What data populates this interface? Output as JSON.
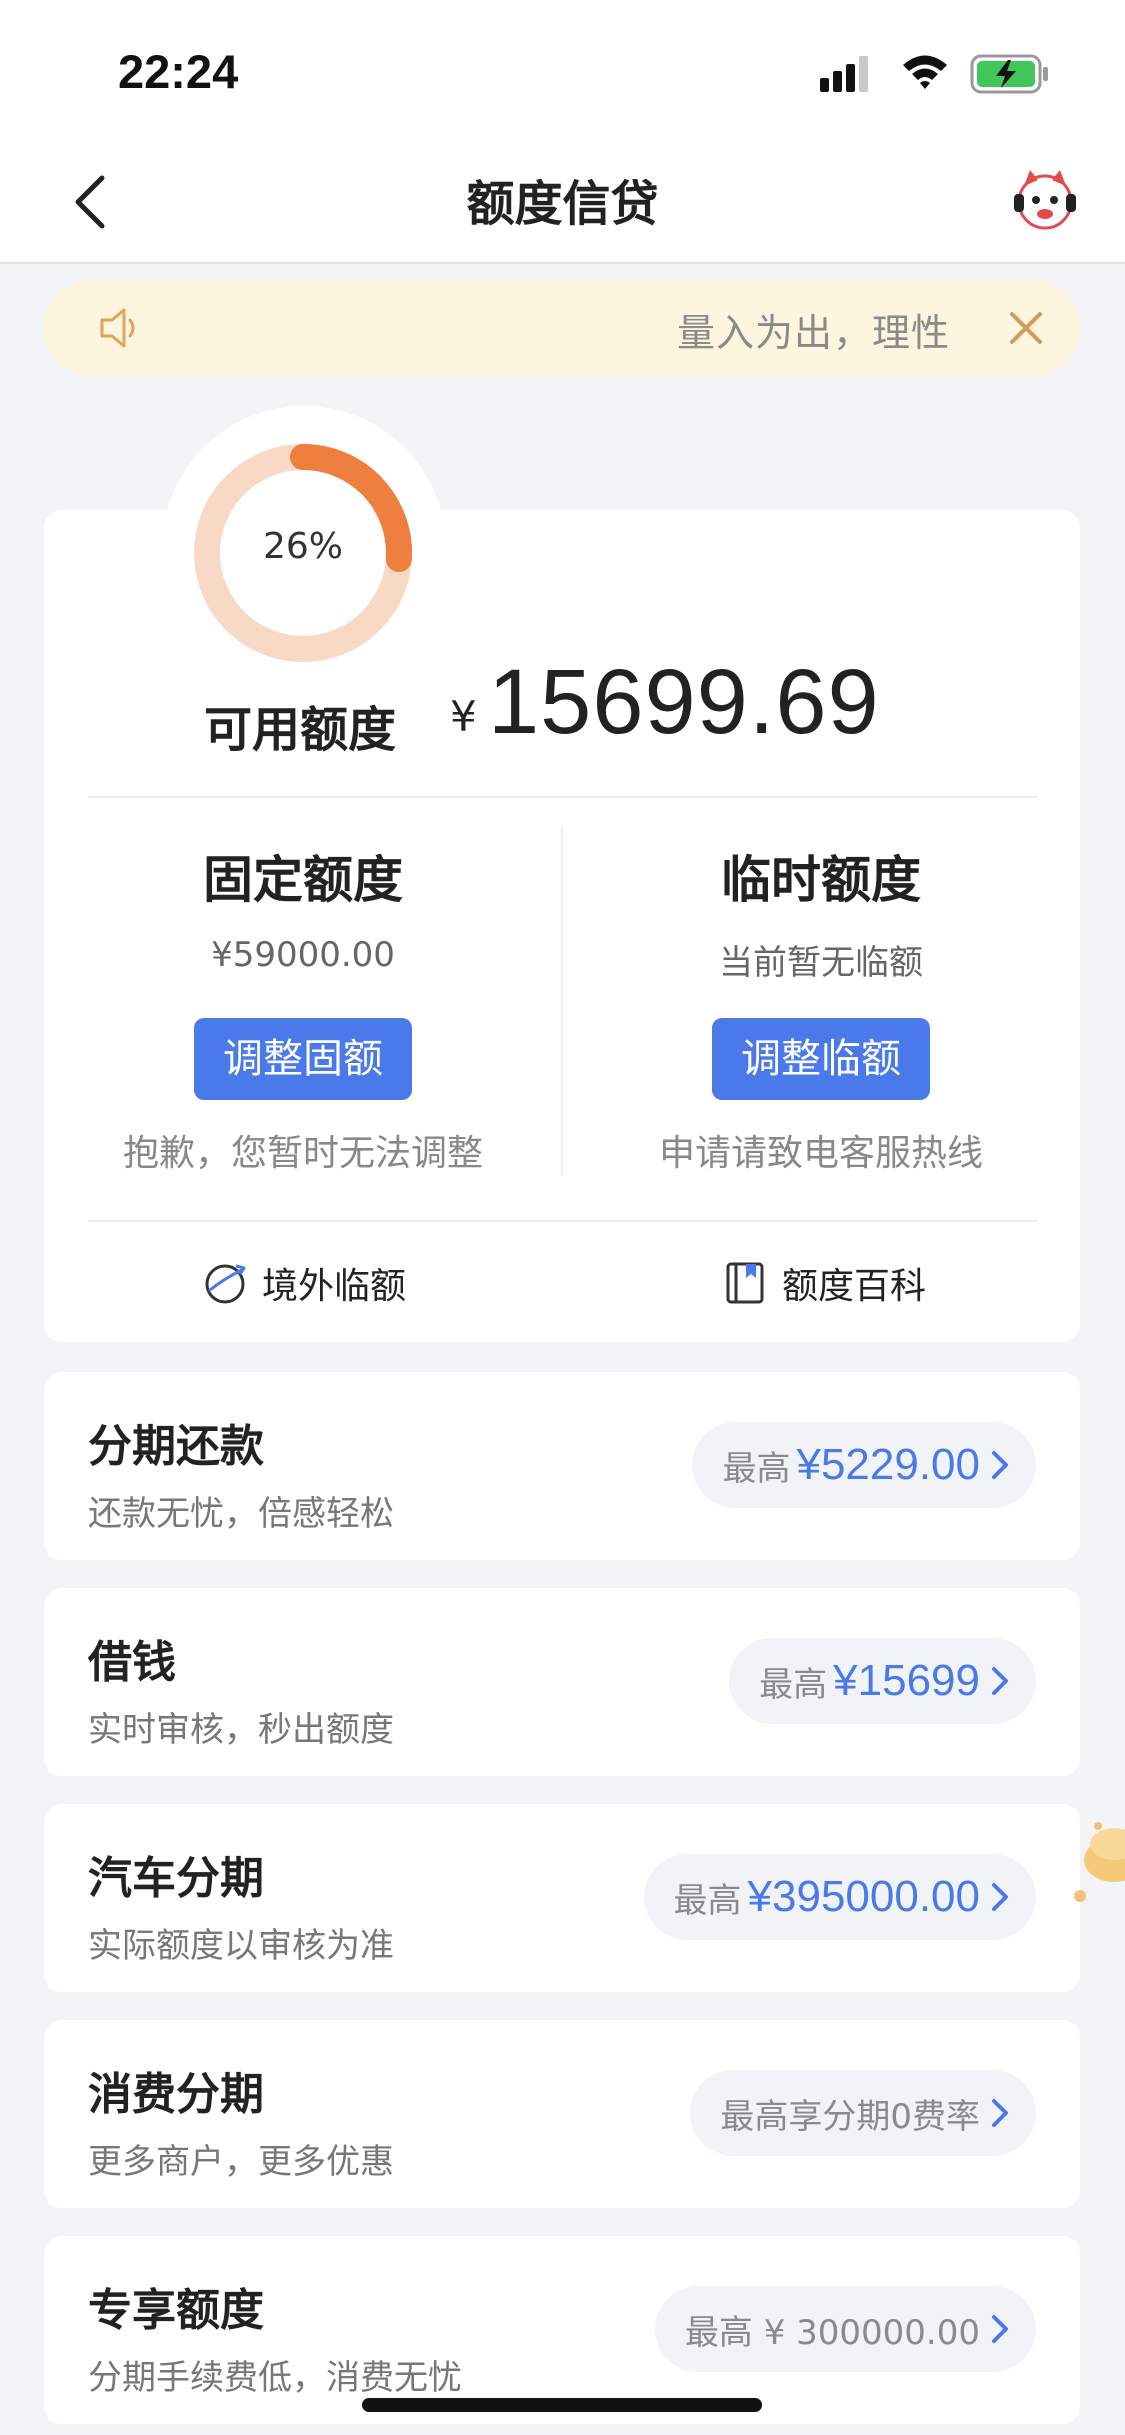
{
  "status_bar": {
    "time": "22:24"
  },
  "nav": {
    "title": "额度信贷"
  },
  "notice": {
    "text": "量入为出，理性"
  },
  "quota": {
    "used_percent_label": "26%",
    "used_percent": 0.26,
    "available_label": "可用额度",
    "currency": "¥",
    "available_amount": "15699.69",
    "fixed": {
      "title": "固定额度",
      "value": "¥59000.00",
      "button": "调整固额",
      "note": "抱歉，您暂时无法调整"
    },
    "temp": {
      "title": "临时额度",
      "value": "当前暂无临额",
      "button": "调整临额",
      "note": "申请请致电客服热线"
    },
    "links": {
      "overseas": "境外临额",
      "wiki": "额度百科"
    }
  },
  "products": [
    {
      "title": "分期还款",
      "subtitle": "还款无忧，倍感轻松",
      "prefix": "最高",
      "amount": "¥5229.00"
    },
    {
      "title": "借钱",
      "subtitle": "实时审核，秒出额度",
      "prefix": "最高",
      "amount": "¥15699"
    },
    {
      "title": "汽车分期",
      "subtitle": "实际额度以审核为准",
      "prefix": "最高",
      "amount": "¥395000.00"
    },
    {
      "title": "消费分期",
      "subtitle": "更多商户，更多优惠",
      "pill_text": "最高享分期0费率"
    },
    {
      "title": "专享额度",
      "subtitle": "分期手续费低，消费无忧",
      "pill_text": "最高 ¥ 300000.00"
    }
  ],
  "colors": {
    "accent": "#4a7ae9",
    "ring_fill": "#ee7f3f",
    "ring_track": "#f8d9c6",
    "notice_bg": "#fdf5dd"
  }
}
